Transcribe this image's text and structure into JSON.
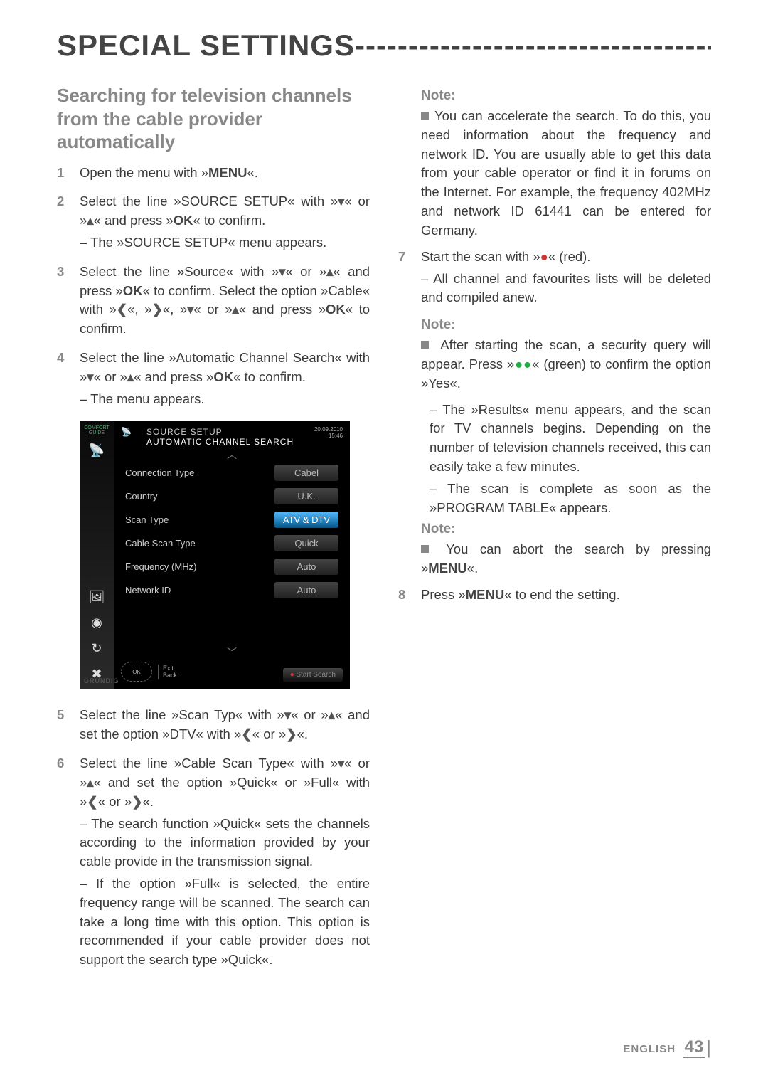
{
  "page": {
    "title": "SPECIAL SETTINGS",
    "title_rule": "----------------------------------------------------------------------------------------------",
    "footer_lang": "ENGLISH",
    "footer_page": "43"
  },
  "heading": "Searching for television channels from the cable provider automatically",
  "left": {
    "s1": {
      "n": "1",
      "t1": "Open the menu with »",
      "menu": "MENU",
      "t2": "«."
    },
    "s2": {
      "n": "2",
      "t1": "Select  the  line  »SOURCE  SETUP«  with  »",
      "down": "▾",
      "t2": "« or »",
      "up": "▴",
      "t3": "« and press »",
      "ok": "OK",
      "t4": "« to confirm.",
      "sub": "The »SOURCE SETUP« menu appears."
    },
    "s3": {
      "n": "3",
      "l1a": "Select   the   line   »Source«   with   »",
      "down": "▾",
      "l1b": "« or »",
      "up": "▴",
      "l1c": "«  and  press  »",
      "ok1": "OK",
      "l1d": "«  to  confirm. Select  the  option  »Cable«  with  »",
      "left": "❮",
      "l1e": "«,  »",
      "right": "❯",
      "l1f": "«, »",
      "down2": "▾",
      "l1g": "« or »",
      "up2": "▴",
      "l1h": "« and press »",
      "ok2": "OK",
      "l1i": "« to confirm."
    },
    "s4": {
      "n": "4",
      "t1": "Select the line »Automatic Channel Search« with »",
      "down": "▾",
      "t2": "« or »",
      "up": "▴",
      "t3": "« and press »",
      "ok": "OK",
      "t4": "« to confirm.",
      "sub": "The menu appears."
    },
    "s5": {
      "n": "5",
      "t1": "Select the line »Scan Typ« with »",
      "down": "▾",
      "t2": "« or »",
      "up": "▴",
      "t3": "« and set the option »DTV« with »",
      "left": "❮",
      "t4": "« or »",
      "right": "❯",
      "t5": "«."
    },
    "s6": {
      "n": "6",
      "t1": "Select the line »Cable Scan Type« with »",
      "down": "▾",
      "t2": "« or »",
      "up": "▴",
      "t3": "« and set the option »Quick« or »Full« with »",
      "left": "❮",
      "t4": "« or »",
      "right": "❯",
      "t5": "«.",
      "sub1": "The search function »Quick« sets the channels according to the information provided by your cable provide in the transmission signal.",
      "sub2": "If the option »Full« is selected, the entire frequency range will be scanned. The search can take a long time with this option. This option is recommended if your cable provider does not support the search type »Quick«."
    }
  },
  "right": {
    "note1_label": "Note:",
    "note1_body": "You can accelerate the search. To do this, you need information about the frequency and network ID. You are usually able to get this data from your cable operator or find it in forums on the Internet. For example, the frequency 402MHz and network ID 61441 can be entered for Germany.",
    "s7": {
      "n": "7",
      "t1": "Start the scan with »",
      "red": "●",
      "t2": "« (red).",
      "sub": "All  channel  and  favourites  lists  will  be deleted and compiled anew."
    },
    "note2_label": "Note:",
    "note2_body_a": "After starting the scan, a security query will appear.  Press  »",
    "note2_green": "●●",
    "note2_body_b": "«  (green)  to  confirm  the option »Yes«.",
    "note2_sub1": "The »Results« menu appears, and the scan for TV channels begins. Depending on the number  of  television  channels  received, this can easily take a few minutes.",
    "note2_sub2": "The scan is complete as soon as the »PROGRAM TABLE« appears.",
    "note3_label": "Note:",
    "note3_body_a": "You  can  abort  the  search  by  pressing »",
    "note3_menu": "MENU",
    "note3_body_b": "«.",
    "s8": {
      "n": "8",
      "t1": "Press »",
      "menu": "MENU",
      "t2": "« to end the setting."
    }
  },
  "tv": {
    "sidebar_label": "COMFORT GUIDE",
    "brand": "GRUNDIG",
    "title1": "SOURCE SETUP",
    "title2": "AUTOMATIC CHANNEL SEARCH",
    "date1": "20.09.2010",
    "date2": "15:46",
    "rows": [
      {
        "k": "Connection Type",
        "v": "Cabel",
        "hi": false
      },
      {
        "k": "Country",
        "v": "U.K.",
        "hi": false
      },
      {
        "k": "Scan Type",
        "v": "ATV & DTV",
        "hi": true
      },
      {
        "k": "Cable Scan Type",
        "v": "Quick",
        "hi": false
      },
      {
        "k": "Frequency (MHz)",
        "v": "Auto",
        "hi": false
      },
      {
        "k": "Network ID",
        "v": "Auto",
        "hi": false
      }
    ],
    "foot1": "Exit",
    "foot2": "Back",
    "ok": "OK",
    "start": "Start Search"
  }
}
